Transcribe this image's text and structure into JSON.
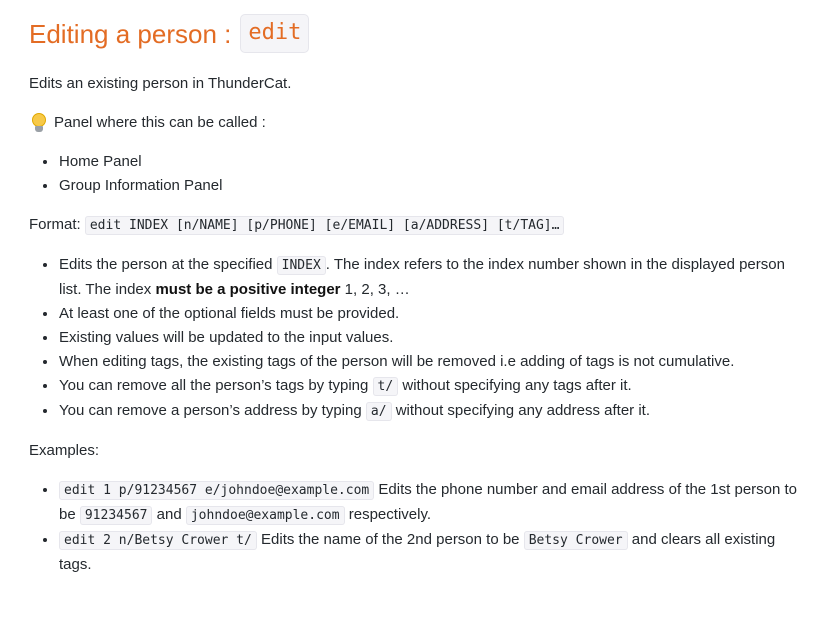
{
  "heading": {
    "text": "Editing a person :",
    "code": "edit"
  },
  "intro": "Edits an existing person in ThunderCat.",
  "panel_line": "Panel where this can be called :",
  "panels": [
    "Home Panel",
    "Group Information Panel"
  ],
  "format": {
    "label": "Format:",
    "code": "edit INDEX [n/NAME] [p/PHONE] [e/EMAIL] [a/ADDRESS] [t/TAG]…"
  },
  "notes": {
    "n1": {
      "a": "Edits the person at the specified",
      "code": "INDEX",
      "b": ". The index refers to the index number shown in the displayed person list. The index",
      "bold": "must be a positive integer",
      "c": "1, 2, 3, …"
    },
    "n2": "At least one of the optional fields must be provided.",
    "n3": "Existing values will be updated to the input values.",
    "n4": "When editing tags, the existing tags of the person will be removed i.e adding of tags is not cumulative.",
    "n5": {
      "a": "You can remove all the person’s tags by typing",
      "code": "t/",
      "b": "without specifying any tags after it."
    },
    "n6": {
      "a": "You can remove a person’s address by typing",
      "code": "a/",
      "b": "without specifying any address after it."
    }
  },
  "examples_label": "Examples:",
  "examples": {
    "e1": {
      "code1": "edit 1 p/91234567 e/johndoe@example.com",
      "a": "Edits the phone number and email address of the 1st person to be",
      "code2": "91234567",
      "b": "and",
      "code3": "johndoe@example.com",
      "c": "respectively."
    },
    "e2": {
      "code1": "edit 2 n/Betsy Crower t/",
      "a": "Edits the name of the 2nd person to be",
      "code2": "Betsy Crower",
      "b": "and clears all existing tags."
    }
  }
}
